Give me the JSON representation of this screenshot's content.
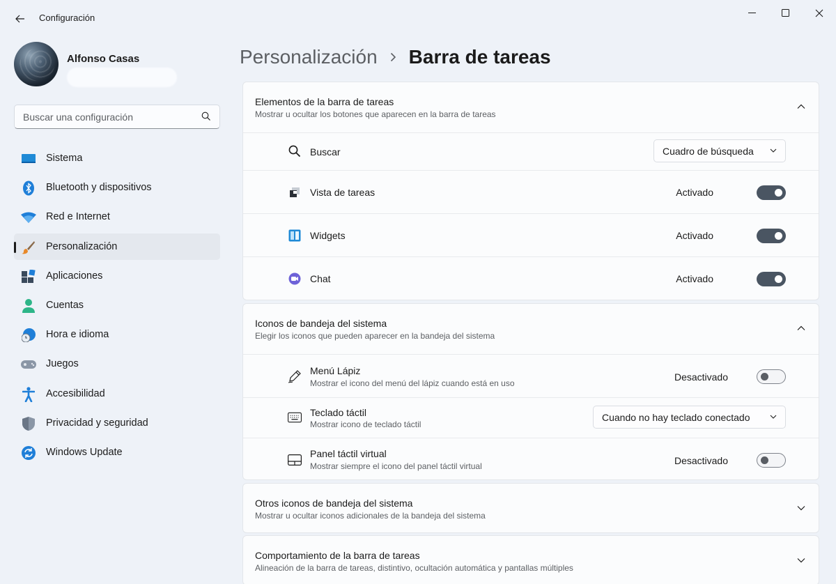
{
  "window": {
    "title": "Configuración"
  },
  "profile": {
    "name": "Alfonso Casas"
  },
  "search": {
    "placeholder": "Buscar una configuración"
  },
  "sidebar": {
    "items": [
      {
        "label": "Sistema",
        "icon": "system-icon"
      },
      {
        "label": "Bluetooth y dispositivos",
        "icon": "bluetooth-icon"
      },
      {
        "label": "Red e Internet",
        "icon": "wifi-icon"
      },
      {
        "label": "Personalización",
        "icon": "brush-icon",
        "active": true
      },
      {
        "label": "Aplicaciones",
        "icon": "apps-icon"
      },
      {
        "label": "Cuentas",
        "icon": "account-icon"
      },
      {
        "label": "Hora e idioma",
        "icon": "globe-clock-icon"
      },
      {
        "label": "Juegos",
        "icon": "gamepad-icon"
      },
      {
        "label": "Accesibilidad",
        "icon": "accessibility-icon"
      },
      {
        "label": "Privacidad y seguridad",
        "icon": "shield-icon"
      },
      {
        "label": "Windows Update",
        "icon": "update-icon"
      }
    ]
  },
  "breadcrumb": {
    "parent": "Personalización",
    "current": "Barra de tareas"
  },
  "cards": {
    "taskbar_items": {
      "title": "Elementos de la barra de tareas",
      "subtitle": "Mostrar u ocultar los botones que aparecen en la barra de tareas",
      "search_label": "Buscar",
      "search_value": "Cuadro de búsqueda",
      "taskview_label": "Vista de tareas",
      "taskview_state": "Activado",
      "widgets_label": "Widgets",
      "widgets_state": "Activado",
      "chat_label": "Chat",
      "chat_state": "Activado"
    },
    "tray_icons": {
      "title": "Iconos de bandeja del sistema",
      "subtitle": "Elegir los iconos que pueden aparecer en la bandeja del sistema",
      "pen_label": "Menú Lápiz",
      "pen_sub": "Mostrar el icono del menú del lápiz cuando está en uso",
      "pen_state": "Desactivado",
      "keyboard_label": "Teclado táctil",
      "keyboard_sub": "Mostrar icono de teclado táctil",
      "keyboard_value": "Cuando no hay teclado conectado",
      "touchpad_label": "Panel táctil virtual",
      "touchpad_sub": "Mostrar siempre el icono del panel táctil virtual",
      "touchpad_state": "Desactivado"
    },
    "other_tray": {
      "title": "Otros iconos de bandeja del sistema",
      "subtitle": "Mostrar u ocultar iconos adicionales de la bandeja del sistema"
    },
    "behavior": {
      "title": "Comportamiento de la barra de tareas",
      "subtitle": "Alineación de la barra de tareas, distintivo, ocultación automática y pantallas múltiples"
    }
  },
  "colors": {
    "accent": "#0067c0",
    "toggle_on": "#4a5562",
    "background": "#eef2f8",
    "card": "#fbfcfd"
  }
}
